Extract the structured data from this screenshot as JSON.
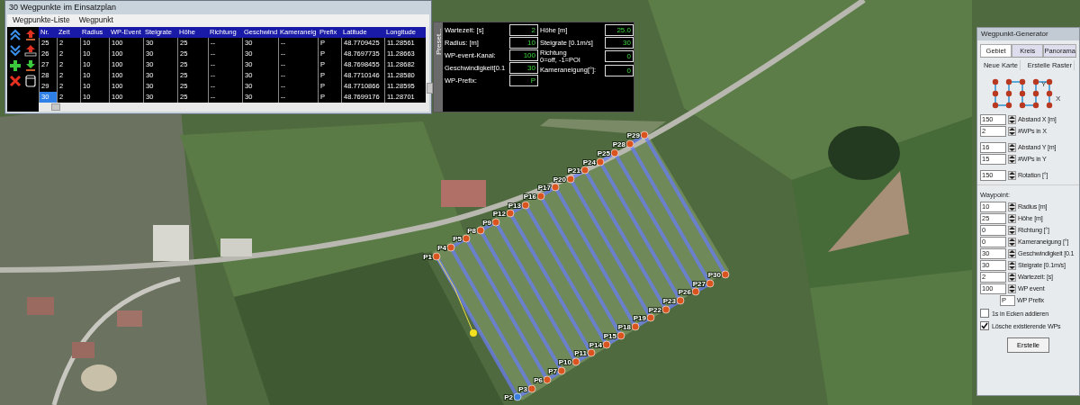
{
  "table_window": {
    "title": "30 Wegpunkte im Einsatzplan",
    "menu": [
      "Wegpunkte-Liste",
      "Wegpunkt"
    ],
    "columns": [
      "Nr.",
      "Zeit",
      "Radius",
      "WP-Event",
      "Steigrate",
      "Höhe",
      "Richtung",
      "Geschwind",
      "Kameraneig",
      "Prefix",
      "Latitude",
      "Longitude"
    ],
    "rows": [
      {
        "selected": false,
        "cells": [
          "25",
          "2",
          "10",
          "100",
          "30",
          "25",
          "--",
          "30",
          "--",
          "P",
          "48.7709425",
          "11.28561"
        ]
      },
      {
        "selected": false,
        "cells": [
          "26",
          "2",
          "10",
          "100",
          "30",
          "25",
          "--",
          "30",
          "--",
          "P",
          "48.7697735",
          "11.28663"
        ]
      },
      {
        "selected": false,
        "cells": [
          "27",
          "2",
          "10",
          "100",
          "30",
          "25",
          "--",
          "30",
          "--",
          "P",
          "48.7698455",
          "11.28682"
        ]
      },
      {
        "selected": false,
        "cells": [
          "28",
          "2",
          "10",
          "100",
          "30",
          "25",
          "--",
          "30",
          "--",
          "P",
          "48.7710146",
          "11.28580"
        ]
      },
      {
        "selected": false,
        "cells": [
          "29",
          "2",
          "10",
          "100",
          "30",
          "25",
          "--",
          "30",
          "--",
          "P",
          "48.7710866",
          "11.28595"
        ]
      },
      {
        "selected": true,
        "cells": [
          "30",
          "2",
          "10",
          "100",
          "30",
          "25",
          "--",
          "30",
          "--",
          "P",
          "48.7699176",
          "11.28701"
        ]
      }
    ]
  },
  "presets": {
    "tab": "Preset...",
    "fields_left": [
      {
        "label": "Wartezeit: [s]",
        "value": "2"
      },
      {
        "label": "Radius: [m]",
        "value": "10"
      },
      {
        "label": "WP-event-Kanal:",
        "value": "100"
      },
      {
        "label": "Geschwindigkeit[0.1",
        "value": "30"
      },
      {
        "label": "WP-Prefix:",
        "value": "P"
      }
    ],
    "fields_right": [
      {
        "label": "Höhe [m]",
        "value": "25.0"
      },
      {
        "label": "Steigrate [0.1m/s]",
        "value": "30"
      },
      {
        "label": "Richtung\n0=off, -1=POI",
        "value": "0"
      },
      {
        "label": "Kameraneigung[°]:",
        "value": "0"
      }
    ]
  },
  "map": {
    "waypoints": [
      {
        "label": "P1",
        "color": "#d9541e"
      },
      {
        "label": "P2",
        "color": "#3a7ee0"
      },
      {
        "label": "P3",
        "color": "#d9541e"
      },
      {
        "label": "P4",
        "color": "#d9541e"
      },
      {
        "label": "P5",
        "color": "#d9541e"
      },
      {
        "label": "P6",
        "color": "#d9541e"
      },
      {
        "label": "P7",
        "color": "#d9541e"
      },
      {
        "label": "P8",
        "color": "#d9541e"
      },
      {
        "label": "P9",
        "color": "#d9541e"
      },
      {
        "label": "P10",
        "color": "#d9541e"
      },
      {
        "label": "P11",
        "color": "#d9541e"
      },
      {
        "label": "P12",
        "color": "#d9541e"
      },
      {
        "label": "P13",
        "color": "#d9541e"
      },
      {
        "label": "P14",
        "color": "#d9541e"
      },
      {
        "label": "P15",
        "color": "#d9541e"
      },
      {
        "label": "P16",
        "color": "#d9541e"
      },
      {
        "label": "P17",
        "color": "#d9541e"
      },
      {
        "label": "P18",
        "color": "#d9541e"
      },
      {
        "label": "P19",
        "color": "#d9541e"
      },
      {
        "label": "P20",
        "color": "#d9541e"
      },
      {
        "label": "P21",
        "color": "#d9541e"
      },
      {
        "label": "P22",
        "color": "#d9541e"
      },
      {
        "label": "P23",
        "color": "#d9541e"
      },
      {
        "label": "P24",
        "color": "#d9541e"
      },
      {
        "label": "P25",
        "color": "#d9541e"
      },
      {
        "label": "P26",
        "color": "#d9541e"
      },
      {
        "label": "P27",
        "color": "#d9541e"
      },
      {
        "label": "P28",
        "color": "#d9541e"
      },
      {
        "label": "P29",
        "color": "#d9541e"
      },
      {
        "label": "P30",
        "color": "#d9541e"
      }
    ]
  },
  "generator": {
    "title": "Wegpunkt-Generator",
    "tabs": [
      {
        "label": "Gebiet",
        "selected": true
      },
      {
        "label": "Kreis",
        "selected": false
      },
      {
        "label": "Panorama",
        "selected": false
      }
    ],
    "actions": [
      "Neue Karte",
      "Erstelle Raster"
    ],
    "grid_labels": [
      "Y",
      "X"
    ],
    "area_fields": [
      {
        "value": "150",
        "label": "Abstand X [m]"
      },
      {
        "value": "2",
        "label": "#WPs in X"
      },
      {
        "value": "16",
        "label": "Abstand Y [m]"
      },
      {
        "value": "15",
        "label": "#WPs in Y"
      },
      {
        "value": "150",
        "label": "Rotation [°]"
      }
    ],
    "waypoint_heading": "Waypoint:",
    "waypoint_fields": [
      {
        "value": "10",
        "label": "Radius [m]"
      },
      {
        "value": "25",
        "label": "Höhe [m]"
      },
      {
        "value": "0",
        "label": "Richtung [°]"
      },
      {
        "value": "0",
        "label": "Kameraneigung [°]"
      },
      {
        "value": "30",
        "label": "Geschwindigkeit [0.1"
      },
      {
        "value": "30",
        "label": "Steigrate [0.1m/s]"
      },
      {
        "value": "2",
        "label": "Wartezeit: [s]"
      },
      {
        "value": "100",
        "label": "WP event"
      }
    ],
    "prefix_field": {
      "value": "P",
      "label": "WP Prefix"
    },
    "checkboxes": [
      {
        "label": "1s in Ecken addieren",
        "checked": false
      },
      {
        "label": "Lösche existierende WPs",
        "checked": true
      }
    ],
    "button": "Erstelle"
  }
}
